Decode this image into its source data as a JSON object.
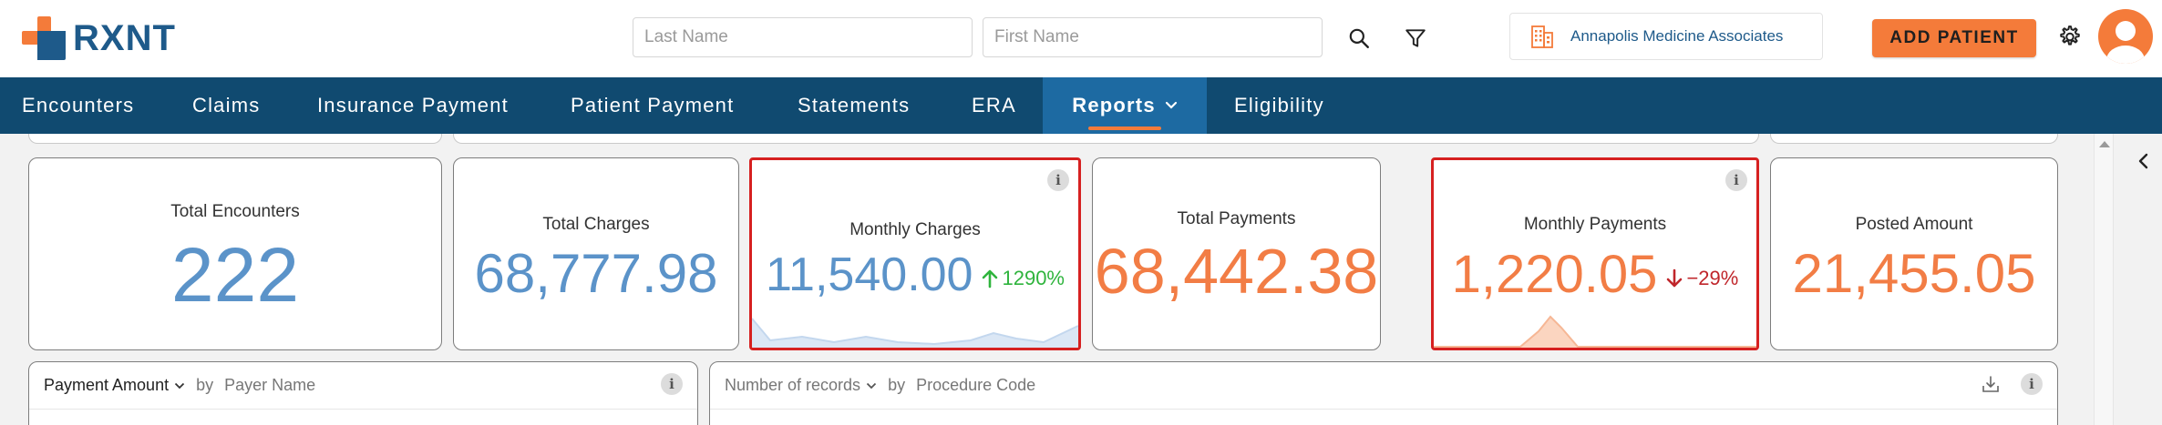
{
  "header": {
    "brand": "RXNT",
    "last_name_placeholder": "Last Name",
    "first_name_placeholder": "First Name",
    "practice_name": "Annapolis Medicine Associates",
    "add_patient_label": "ADD PATIENT"
  },
  "nav": {
    "items": [
      {
        "label": "Encounters"
      },
      {
        "label": "Claims"
      },
      {
        "label": "Insurance Payment"
      },
      {
        "label": "Patient Payment"
      },
      {
        "label": "Statements"
      },
      {
        "label": "ERA"
      },
      {
        "label": "Reports",
        "active": true
      },
      {
        "label": "Eligibility"
      }
    ]
  },
  "kpis": {
    "total_encounters": {
      "title": "Total Encounters",
      "value": "222"
    },
    "total_charges": {
      "title": "Total Charges",
      "value": "68,777.98"
    },
    "monthly_charges": {
      "title": "Monthly Charges",
      "value": "11,540.00",
      "change": "1290%",
      "direction": "up"
    },
    "total_payments": {
      "title": "Total Payments",
      "value": "68,442.38"
    },
    "monthly_payments": {
      "title": "Monthly Payments",
      "value": "1,220.05",
      "change": "−29%",
      "direction": "down"
    },
    "posted_amount": {
      "title": "Posted Amount",
      "value": "21,455.05"
    }
  },
  "panels": {
    "payer": {
      "metric": "Payment Amount",
      "by": "by",
      "dimension": "Payer Name"
    },
    "procedure": {
      "metric": "Number of records",
      "by": "by",
      "dimension": "Procedure Code"
    }
  },
  "info_glyph": "i",
  "colors": {
    "brand_orange": "#f47b3a",
    "brand_blue": "#1e5a8a",
    "nav_bg": "#104a70",
    "nav_active": "#1d6aa2",
    "kpi_blue": "#5b93c9",
    "kpi_orange": "#f27d45",
    "up_green": "#2fb43d",
    "down_red": "#c0262b",
    "highlight_red": "#d62020"
  }
}
